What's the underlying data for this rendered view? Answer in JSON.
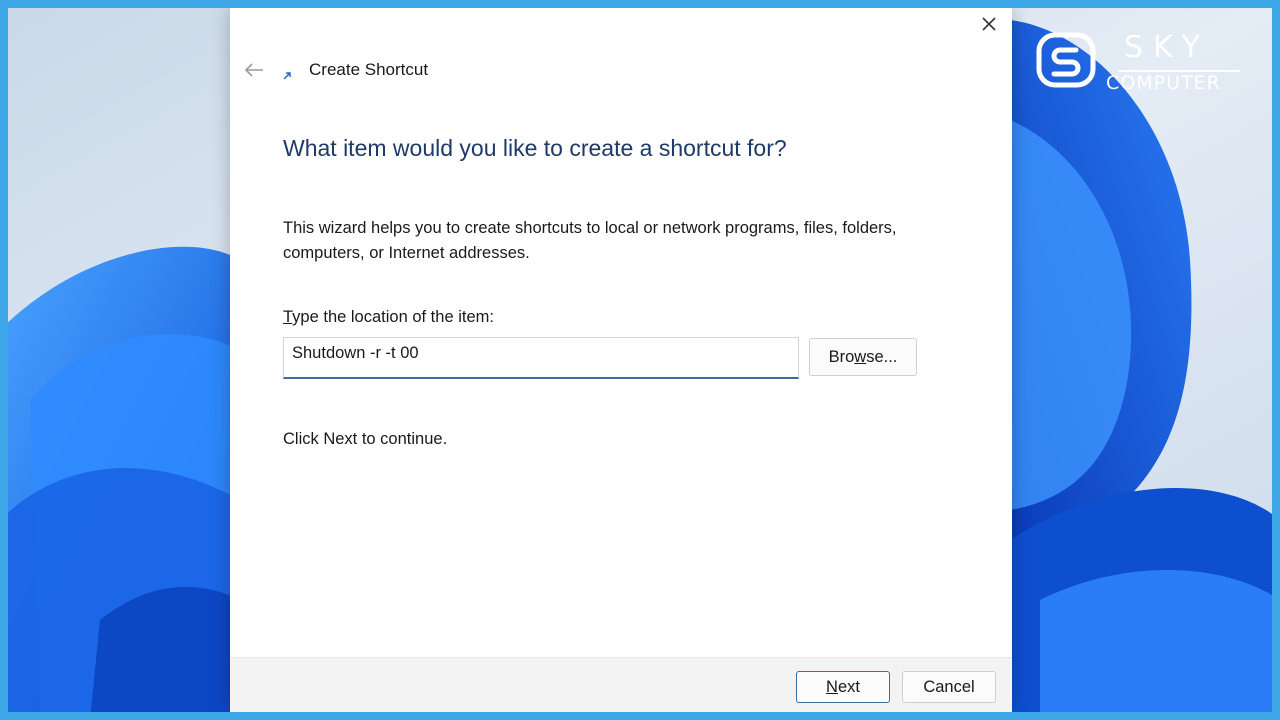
{
  "watermark": {
    "brand_top": "SKY",
    "brand_bottom": "COMPUTER"
  },
  "dialog": {
    "title": "Create Shortcut",
    "heading": "What item would you like to create a shortcut for?",
    "description": "This wizard helps you to create shortcuts to local or network programs, files, folders, computers, or Internet addresses.",
    "location_label_first": "T",
    "location_label_rest": "ype the location of the item:",
    "location_value": "Shutdown -r -t 00",
    "browse_label_before": "Bro",
    "browse_label_underlined": "w",
    "browse_label_after": "se...",
    "hint": "Click Next to continue.",
    "next_label_underlined": "N",
    "next_label_rest": "ext",
    "cancel_label": "Cancel"
  },
  "colors": {
    "accent": "#3b6ea0",
    "heading": "#1f3a68",
    "frame": "#3ea7e8",
    "wallpaper_blue": "#1e6fe0"
  },
  "icons": {
    "back": "arrow-left-icon",
    "close": "close-icon",
    "shortcut": "shortcut-arrow-icon",
    "brand": "sky-logo-icon"
  }
}
